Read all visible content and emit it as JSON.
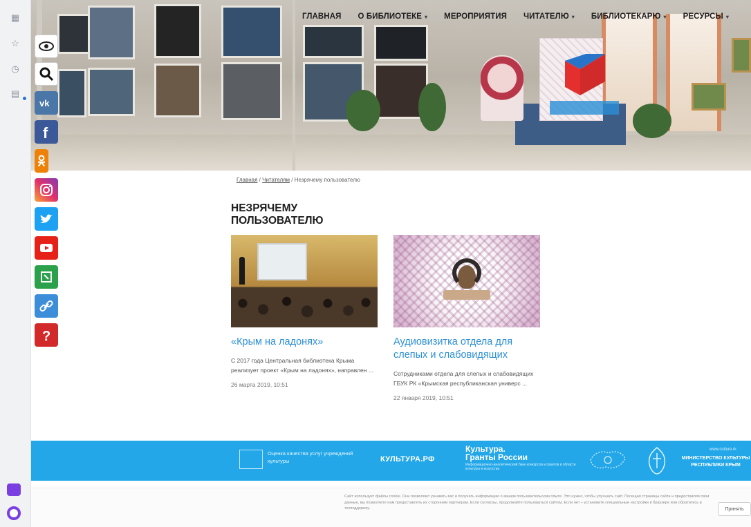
{
  "nav": {
    "items": [
      {
        "label": "ГЛАВНАЯ",
        "dropdown": false
      },
      {
        "label": "О БИБЛИОТЕКЕ",
        "dropdown": true
      },
      {
        "label": "МЕРОПРИЯТИЯ",
        "dropdown": false
      },
      {
        "label": "ЧИТАТЕЛЮ",
        "dropdown": true
      },
      {
        "label": "БИБЛИОТЕКАРЮ",
        "dropdown": true
      },
      {
        "label": "РЕСУРСЫ",
        "dropdown": true
      }
    ],
    "caret": "▾"
  },
  "social": [
    {
      "name": "accessibility-eye-icon",
      "color": "#ffffff"
    },
    {
      "name": "search-icon",
      "color": "#ffffff"
    },
    {
      "name": "vk-icon",
      "color": "#4a76a8"
    },
    {
      "name": "facebook-icon",
      "color": "#3b5998"
    },
    {
      "name": "odnoklassniki-icon",
      "color": "#ee8208"
    },
    {
      "name": "instagram-icon",
      "color": "#c13584"
    },
    {
      "name": "twitter-icon",
      "color": "#1da1f2"
    },
    {
      "name": "youtube-icon",
      "color": "#e62117"
    },
    {
      "name": "liveinternet-icon",
      "color": "#2aa14a"
    },
    {
      "name": "link-icon",
      "color": "#3d8ed9"
    },
    {
      "name": "help-icon",
      "color": "#d22a2a"
    }
  ],
  "breadcrumb": {
    "home": "Главная",
    "sep": " / ",
    "category": "Читателям",
    "current": "Незрячему пользователю"
  },
  "page": {
    "title": "НЕЗРЯЧЕМУ ПОЛЬЗОВАТЕЛЮ"
  },
  "cards": [
    {
      "title": "«Крым на ладонях»",
      "text": "С 2017 года Центральная библиотека Крыма реализует проект «Крым на ладонях», направлен ...",
      "date": "26 марта 2019, 10:51"
    },
    {
      "title": "Аудиовизитка отдела для слепых и слабовидящих",
      "text": "Сотрудниками отдела для слепых и слабовидящих ГБУК РК «Крымская республиканская универс ...",
      "date": "22 января 2019, 10:51"
    }
  ],
  "footer": {
    "quality": "Оценка качества услуг учреждений культуры",
    "kultura": "КУЛЬТУРА.РФ",
    "grants_title_1": "Культура.",
    "grants_title_2": "Гранты России",
    "grants_sub": "Информационно-аналитический банк конкурсов и грантов в области культуры и искусства",
    "min_site": "www.culture.rk",
    "min_name": "МИНИСТЕРСТВО КУЛЬТУРЫ РЕСПУБЛИКИ КРЫМ",
    "colors": {
      "band": "#23a7e8"
    }
  },
  "cookie": {
    "text": "Сайт использует файлы cookie. Они позволяют узнавать вас и получать информацию о вашем пользовательском опыте. Это нужно, чтобы улучшать сайт. Посещая страницы сайта и предоставляя свои данные, вы позволяете нам предоставлять их сторонним партнерам. Если согласны, продолжайте пользоваться сайтом. Если нет – установите специальные настройки в браузере или обратитесь в техподдержку.",
    "button": "Принять"
  }
}
